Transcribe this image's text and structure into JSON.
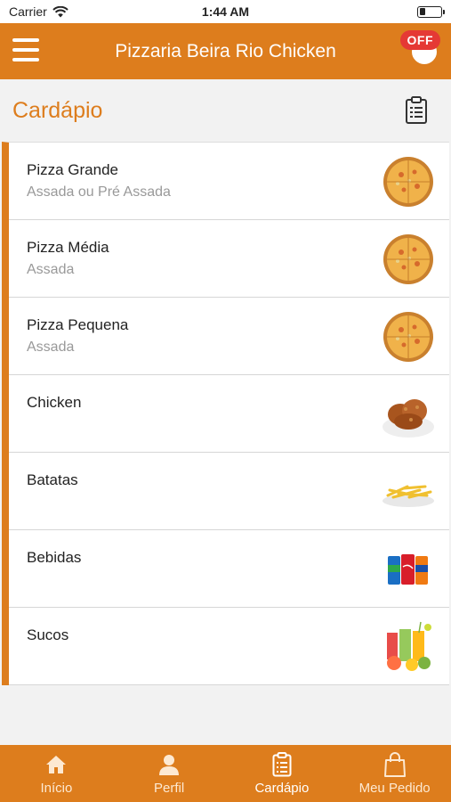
{
  "status_bar": {
    "carrier": "Carrier",
    "time": "1:44 AM"
  },
  "nav": {
    "title": "Pizzaria Beira Rio Chicken",
    "badge": "OFF"
  },
  "page": {
    "title": "Cardápio"
  },
  "menu_items": [
    {
      "title": "Pizza Grande",
      "subtitle": "Assada ou Pré Assada",
      "icon": "pizza-image"
    },
    {
      "title": "Pizza Média",
      "subtitle": "Assada",
      "icon": "pizza-image"
    },
    {
      "title": "Pizza Pequena",
      "subtitle": "Assada",
      "icon": "pizza-image"
    },
    {
      "title": "Chicken",
      "subtitle": "",
      "icon": "chicken-image"
    },
    {
      "title": "Batatas",
      "subtitle": "",
      "icon": "fries-image"
    },
    {
      "title": "Bebidas",
      "subtitle": "",
      "icon": "soda-cans-image"
    },
    {
      "title": "Sucos",
      "subtitle": "",
      "icon": "juice-image"
    }
  ],
  "tabs": [
    {
      "label": "Início",
      "icon": "home-icon",
      "active": false
    },
    {
      "label": "Perfil",
      "icon": "person-icon",
      "active": false
    },
    {
      "label": "Cardápio",
      "icon": "clipboard-icon",
      "active": true
    },
    {
      "label": "Meu Pedido",
      "icon": "shopping-bag-icon",
      "active": false
    }
  ],
  "colors": {
    "accent": "#dd7d1d",
    "badge": "#e53935",
    "subtitle": "#999999"
  }
}
